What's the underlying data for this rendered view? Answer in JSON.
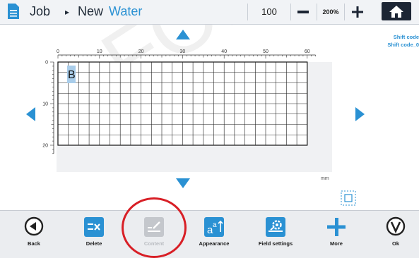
{
  "header": {
    "crumb_job": "Job",
    "crumb_separator": "▸",
    "crumb_new": "New",
    "crumb_field": "Water",
    "zoom_value": "100",
    "zoom_percent": "200%"
  },
  "shift_codes": [
    "Shift code",
    "Shift code_0"
  ],
  "canvas": {
    "x_ticks": [
      "0",
      "10",
      "20",
      "30",
      "40",
      "50",
      "60"
    ],
    "y_ticks": [
      "0",
      "10",
      "20"
    ],
    "field_letter": "B",
    "unit": "mm"
  },
  "toolbar": {
    "back": "Back",
    "delete": "Delete",
    "content": "Content",
    "appearance": "Appearance",
    "field_settings": "Field settings",
    "more": "More",
    "ok": "Ok"
  },
  "watermark": "FOR INT",
  "colors": {
    "accent": "#2a91d3",
    "highlight": "#d81f26",
    "home_button": "#1c2534"
  }
}
